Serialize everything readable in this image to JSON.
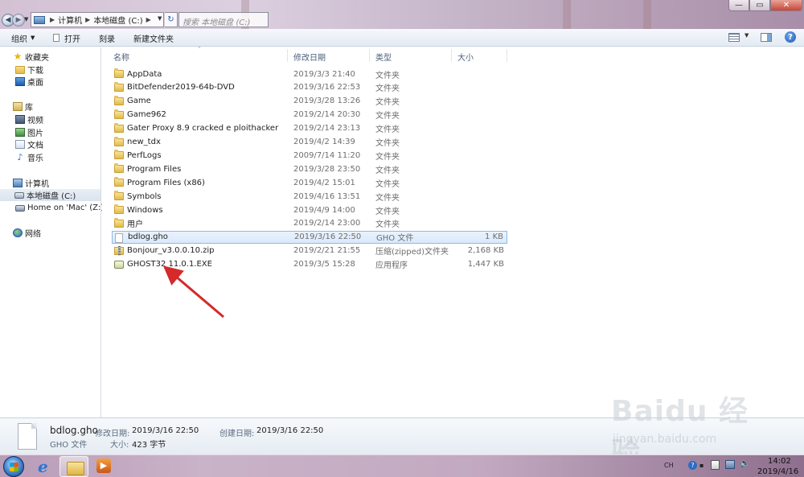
{
  "address": {
    "crumbs": [
      "计算机",
      "本地磁盘 (C:)"
    ],
    "search_placeholder": "搜索 本地磁盘 (C:)"
  },
  "window_controls": {
    "minimize": "—",
    "maximize": "▭",
    "close": "✕"
  },
  "toolbar": {
    "organize": "组织",
    "open": "打开",
    "burn": "刻录",
    "new_folder": "新建文件夹"
  },
  "nav": {
    "favorites": "收藏夹",
    "downloads": "下载",
    "desktop": "桌面",
    "libraries": "库",
    "videos": "视频",
    "pictures": "图片",
    "documents": "文档",
    "music": "音乐",
    "computer": "计算机",
    "local_disk": "本地磁盘 (C:)",
    "mac_drive": "Home on 'Mac' (Z:)",
    "network": "网络"
  },
  "columns": {
    "name": "名称",
    "date": "修改日期",
    "type": "类型",
    "size": "大小"
  },
  "files": [
    {
      "name": "AppData",
      "date": "2019/3/3 21:40",
      "type": "文件夹",
      "size": "",
      "icon": "folder-icon"
    },
    {
      "name": "BitDefender2019-64b-DVD",
      "date": "2019/3/16 22:53",
      "type": "文件夹",
      "size": "",
      "icon": "folder-icon"
    },
    {
      "name": "Game",
      "date": "2019/3/28 13:26",
      "type": "文件夹",
      "size": "",
      "icon": "folder-icon"
    },
    {
      "name": "Game962",
      "date": "2019/2/14 20:30",
      "type": "文件夹",
      "size": "",
      "icon": "folder-icon"
    },
    {
      "name": "Gater Proxy 8.9 cracked e ploithacker",
      "date": "2019/2/14 23:13",
      "type": "文件夹",
      "size": "",
      "icon": "folder-icon"
    },
    {
      "name": "new_tdx",
      "date": "2019/4/2 14:39",
      "type": "文件夹",
      "size": "",
      "icon": "folder-icon"
    },
    {
      "name": "PerfLogs",
      "date": "2009/7/14 11:20",
      "type": "文件夹",
      "size": "",
      "icon": "folder-icon"
    },
    {
      "name": "Program Files",
      "date": "2019/3/28 23:50",
      "type": "文件夹",
      "size": "",
      "icon": "folder-icon"
    },
    {
      "name": "Program Files (x86)",
      "date": "2019/4/2 15:01",
      "type": "文件夹",
      "size": "",
      "icon": "folder-icon"
    },
    {
      "name": "Symbols",
      "date": "2019/4/16 13:51",
      "type": "文件夹",
      "size": "",
      "icon": "folder-icon"
    },
    {
      "name": "Windows",
      "date": "2019/4/9 14:00",
      "type": "文件夹",
      "size": "",
      "icon": "folder-icon"
    },
    {
      "name": "用户",
      "date": "2019/2/14 23:00",
      "type": "文件夹",
      "size": "",
      "icon": "folder-icon"
    },
    {
      "name": "bdlog.gho",
      "date": "2019/3/16 22:50",
      "type": "GHO 文件",
      "size": "1 KB",
      "icon": "file-icon",
      "selected": true
    },
    {
      "name": "Bonjour_v3.0.0.10.zip",
      "date": "2019/2/21 21:55",
      "type": "压缩(zipped)文件夹",
      "size": "2,168 KB",
      "icon": "zip-icon"
    },
    {
      "name": "GHOST32 11.0.1.EXE",
      "date": "2019/3/5 15:28",
      "type": "应用程序",
      "size": "1,447 KB",
      "icon": "exe-icon"
    }
  ],
  "details": {
    "filename": "bdlog.gho",
    "filetype": "GHO 文件",
    "modified_label": "修改日期:",
    "modified_value": "2019/3/16 22:50",
    "created_label": "创建日期:",
    "created_value": "2019/3/16 22:50",
    "size_label": "大小:",
    "size_value": "423 字节"
  },
  "taskbar": {
    "lang": "CH",
    "clock_time": "14:02",
    "clock_date": "2019/4/16"
  },
  "watermark": {
    "logo": "Baidu 经验",
    "url": "jingyan.baidu.com"
  },
  "colors": {
    "selection": "#d9e9fb",
    "arrow": "#d42a2a",
    "header_text": "#4c607a"
  }
}
